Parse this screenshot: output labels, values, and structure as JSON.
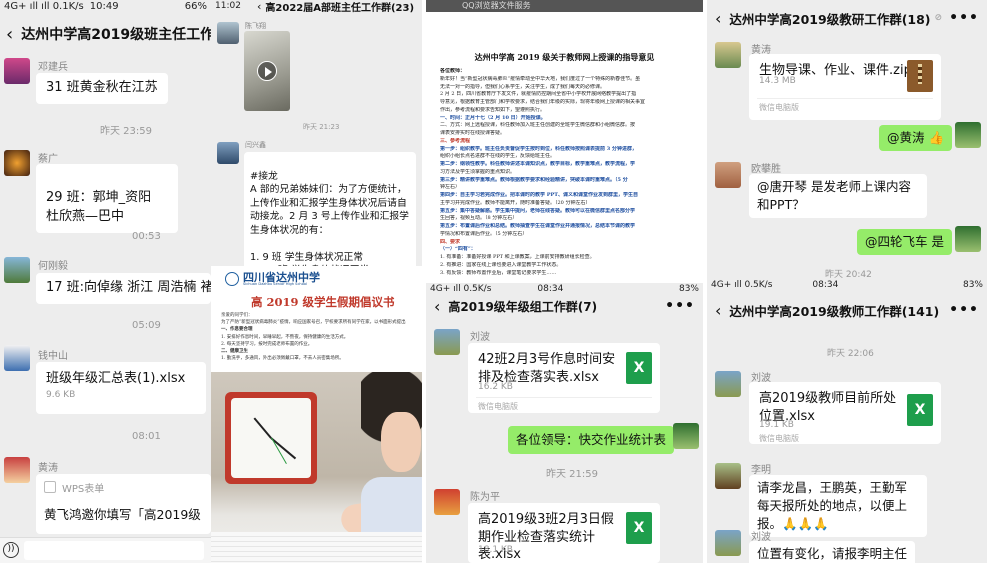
{
  "panel1": {
    "status_time": "10:49",
    "status_left": "4G+ ıll ıll 0.1K/s",
    "status_right": "66%",
    "title": "达州中学高2019级班主任工作群",
    "messages": [
      {
        "sender": "邓建兵",
        "text": "31 班黄金秋在江苏"
      },
      {
        "time": "昨天 23:59"
      },
      {
        "sender": "蔡广",
        "text": "29 班：郭坤_资阳\n杜欣燕—巴中"
      },
      {
        "time": "00:53"
      },
      {
        "sender": "何刚毅",
        "text": "17 班:向倬缘 浙江  周浩楠  褚"
      },
      {
        "time": "05:09"
      },
      {
        "sender": "钱中山",
        "file": "班级年级汇总表(1).xlsx",
        "size": "9.6 KB"
      },
      {
        "time": "08:01"
      },
      {
        "sender": "黄涛",
        "source": "WPS表单",
        "text": "黄飞鸿邀你填写「高2019级"
      }
    ]
  },
  "panel2": {
    "status_time": "11:02",
    "title": "高2022届A部班主任工作群(23)",
    "messages": [
      {
        "sender": "陈飞翔",
        "video": true
      },
      {
        "time": "昨天 21:23"
      },
      {
        "sender": "闫兴鑫",
        "text": "#接龙\nA 部的兄弟姊妹们：为了方便统计，上传作业和汇报学生身体状况后请自动接龙。2 月 3 号上传作业和汇报学生身体状况的有：\n\n1. 9 班  学生身体状况正常\n2. 11 班  学生身体状况正常\n3. 13 班  学生身体状况正常"
      }
    ]
  },
  "proposal": {
    "school": "四川省达州中学",
    "school_en": "Sichuan Dazhou Senior High School",
    "title": "高 2019 级学生假期倡议书",
    "lines": [
      "亲爱的同学们：",
      "为了严防“新型冠状病毒肺炎”疫情，响应国家号召，学校要求所有同学在家，以书面形式提出",
      "一、作息要合理",
      "1. 安排好作息时间，早睡早起，不熬夜，保持健康的生活方式。",
      "2. 每天坚持学习，按时完成老师布置的作业。",
      "二、健康卫生",
      "1. 勤洗手，多通风，外出必须佩戴口罩，不去人员密集场所。"
    ]
  },
  "panel3": {
    "header": "QQ浏览器文件服务",
    "doc_title": "达州中学高 2019 级关于教师网上授课的指导意见",
    "doc_lines": [
      {
        "t": "各位教师：",
        "c": "bold"
      },
      {
        "t": "    新年好！当“新型冠状病毒肺炎”疫情牵动全中华大地，我们度过了一个特殊的新春佳节。虽"
      },
      {
        "t": "无法一对一的指导，但我们心系学生，关注学生，成了我们每天的必修课。"
      },
      {
        "t": "    2 月 2 日，四川省教育厅下发文件，就疫情防控期间全省中小学校开展网络教学提出了指"
      },
      {
        "t": "导意见，根据教育主管部门和学校要求，结合我们年级的实际，现将年级网上授课的相关事宜"
      },
      {
        "t": "作出，参考流程和要求告知如下，望遵照执行。"
      },
      {
        "t": "一、时间：正月十七（2 月 10 日）开始授课。",
        "c": "blue"
      },
      {
        "t": "二、方式：网上远程授课，科任教师加入班主任创建的全班学生微信群和小组微信群。按"
      },
      {
        "t": "课表安排实时在线授课答疑。"
      },
      {
        "t": "三、参考流程",
        "c": "red"
      },
      {
        "t": "    第一步：组织教学。班主任负责督促学生按时到位，科任教师按照课表提前 3 分钟进群，",
        "c": "blue"
      },
      {
        "t": "组织小组长点名进群不在线的学生，反馈给班主任。"
      },
      {
        "t": "    第二步：纲领性教学。科任教师讲述本课知识点，教学目标，教学重难点，教学流程，学",
        "c": "blue"
      },
      {
        "t": "习方法及学生须掌握的重点知识。"
      },
      {
        "t": "    第三步：精讲教学重难点。教师根据教学要求和经验精讲，突破本课时重难点。（5 分",
        "c": "blue"
      },
      {
        "t": "钟左右）"
      },
      {
        "t": "    第四步：自主学习若完成作业。把本课时的教学 PPT、课义和课堂作业发到群里，学生自",
        "c": "blue"
      },
      {
        "t": "主学习并完成作业。教师不能离开，随时准备答疑。（20 分钟左右）"
      },
      {
        "t": "    第五步：集中答疑解惑。学生集中提问，老师在线答疑。教师可以在微信群里点名部分学",
        "c": "blue"
      },
      {
        "t": "生回答，视频互动。（8 分钟左右）"
      },
      {
        "t": "    第五步：布置课后作业和总结。教师抽查学生在课堂作业并通报情况，总结本节课的教学",
        "c": "blue"
      },
      {
        "t": "学情况和布置课后作业。（5 分钟左右）"
      },
      {
        "t": "四、要求",
        "c": "red"
      },
      {
        "t": "  （一）“四有”：",
        "c": "blue"
      },
      {
        "t": "1. 有准备：准备好授课 PPT 和上课教案，上课前安排教研组长检查。"
      },
      {
        "t": "2. 有推进：国家在线上课也要进入课堂教学工作状态。"
      },
      {
        "t": "3. 有反馈：教师布置作业后，课堂笔记要求学生……"
      }
    ]
  },
  "panel4": {
    "status_left": "4G+ ıll 0.5K/s",
    "status_time": "08:34",
    "status_right": "83%",
    "title": "高2019级年级组工作群(7)",
    "messages": [
      {
        "sender": "刘波",
        "file": "42班2月3号作息时间安排及检查落实表.xlsx",
        "size": "16.2 KB",
        "source": "微信电脑版"
      },
      {
        "text": "各位领导：快交作业统计表",
        "self": true
      },
      {
        "time": "昨天 21:59"
      },
      {
        "sender": "陈为平",
        "file": "高2019级3班2月3日假期作业检查落实统计表.xlsx",
        "size": "18.1 KB"
      }
    ]
  },
  "panel5": {
    "title": "达州中学高2019级教研工作群(18)",
    "messages": [
      {
        "sender": "黄涛",
        "file": "生物导课、作业、课件.zip",
        "size": "14.3 MB",
        "source": "微信电脑版"
      },
      {
        "text": "@黄涛 👍",
        "self": true
      },
      {
        "sender": "欧攀胜",
        "text": "@唐开琴 是发老师上课内容和PPT？"
      },
      {
        "text": "@四轮飞车 是",
        "self": true
      },
      {
        "time": "昨天 20:42"
      }
    ]
  },
  "panel6": {
    "title": "达州中学高2019级教师工作群(141)",
    "messages": [
      {
        "time": "昨天 22:06"
      },
      {
        "sender": "刘波",
        "file": "高2019级教师目前所处位置.xlsx",
        "size": "19.1 KB",
        "source": "微信电脑版"
      },
      {
        "sender": "李明",
        "text": "请李龙昌，王鹏英，王勤军每天报所处的地点，以便上报。🙏🙏🙏"
      },
      {
        "sender": "刘波",
        "text": "位置有变化，请报李明主任"
      }
    ]
  }
}
